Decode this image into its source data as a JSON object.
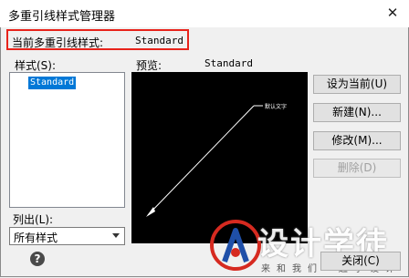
{
  "window": {
    "title": "多重引线样式管理器",
    "close_glyph": "✕"
  },
  "current": {
    "label": "当前多重引线样式:",
    "value": "Standard"
  },
  "styles": {
    "label": "样式(S):",
    "items": [
      "Standard"
    ]
  },
  "preview": {
    "label": "预览:",
    "style_name": "Standard",
    "sample_text": "默认文字"
  },
  "buttons": {
    "set_current": "设为当前(U)",
    "new": "新建(N)...",
    "modify": "修改(M)...",
    "delete": "删除(D)",
    "close": "关闭(C)"
  },
  "list_filter": {
    "label": "列出(L):",
    "value": "所有样式"
  },
  "help": {
    "glyph": "?",
    "icon": "help-icon"
  },
  "watermark": {
    "text": "设计学徒",
    "subtext": "来和我们一起学设计",
    "accent_red": "#d62a20",
    "accent_blue": "#1f4fa8"
  }
}
